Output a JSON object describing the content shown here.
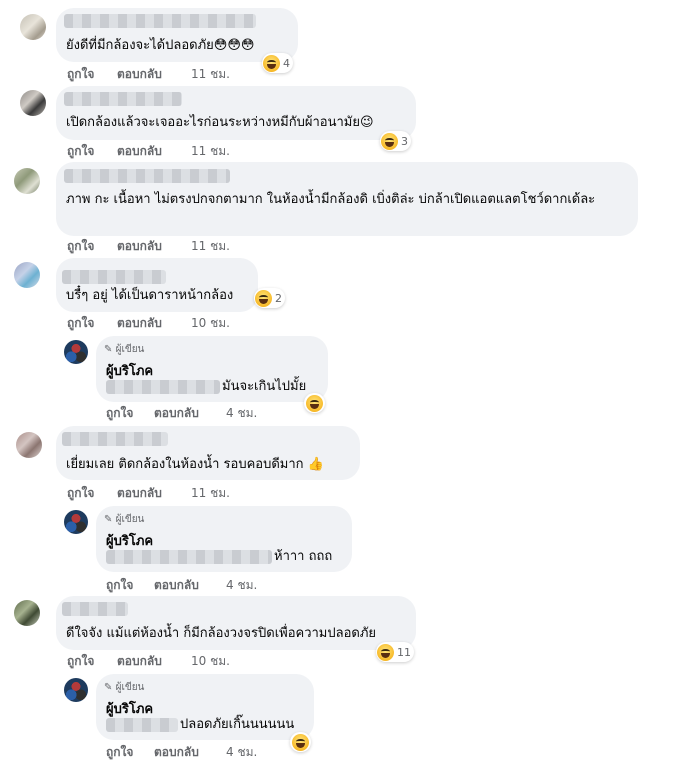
{
  "actions": {
    "like": "ถูกใจ",
    "reply": "ตอบกลับ"
  },
  "comments": [
    {
      "text": "ยังดีที่มีกล้องจะได้ปลอดภัย😳😳😳",
      "time": "11 ชม.",
      "reactions": "4"
    },
    {
      "text": "เปิดกล้องแล้วจะเจออะไรก่อนระหว่างหมีกับผ้าอนามัย😉",
      "time": "11 ชม.",
      "reactions": "3"
    },
    {
      "text": "ภาพ กะ เนื้อหา ไม่ตรงปกจกตามาก ในห้องน้ำมีกล้องดิ เบิ่งติล่ะ บ่กล้าเปิดแอตแลตโชว์ดากเด้ละ",
      "time": "11 ชม."
    },
    {
      "text": "บรื๋ๆ อยู่ ได้เป็นดาราหน้ากล้อง",
      "time": "10 ชม.",
      "reactions": "2"
    },
    {
      "text": "เยี่ยมเลย ติดกล้องในห้องน้ำ รอบคอบดีมาก",
      "time": "11 ชม.",
      "emoji": "👍"
    },
    {
      "text": "ดีใจจัง แม้แต่ห้องน้ำ ก็มีกล้องวงจรปิดเพื่อความปลอดภัย",
      "time": "10 ชม.",
      "reactions": "11"
    }
  ],
  "replies": [
    {
      "tag": "ผู้เขียน",
      "name": "ผู้บริโภค",
      "text": "มันจะเกินไปมั้ย",
      "time": "4 ชม."
    },
    {
      "tag": "ผู้เขียน",
      "name": "ผู้บริโภค",
      "text": "ห้าาา ถถถ",
      "time": "4 ชม."
    },
    {
      "tag": "ผู้เขียน",
      "name": "ผู้บริโภค",
      "text": "ปลอดภัยเกิ๊นนนนนน",
      "time": "4 ชม."
    }
  ],
  "icons": {
    "pen": "pen-icon",
    "reaction": "haha-emoji-icon"
  },
  "colors": {
    "bubble": "#f0f2f5",
    "meta": "#65676b",
    "text": "#050505"
  }
}
